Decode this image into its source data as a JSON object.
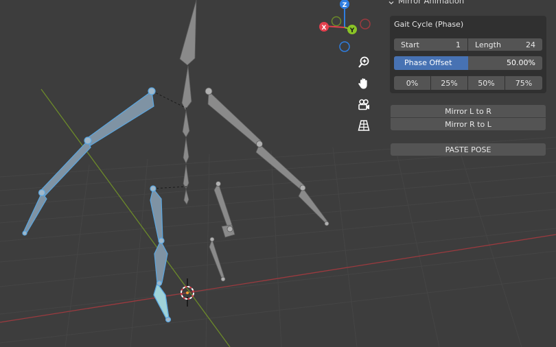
{
  "panel": {
    "title": "Mirror Animation",
    "gait_title": "Gait Cycle (Phase)",
    "start_label": "Start",
    "start_value": "1",
    "length_label": "Length",
    "length_value": "24",
    "phase_label": "Phase Offset",
    "phase_value": "50.00%",
    "phase_fraction": 0.5,
    "presets": [
      "0%",
      "25%",
      "50%",
      "75%"
    ],
    "mirror_lr": "Mirror L to R",
    "mirror_rl": "Mirror R to L",
    "paste_pose": "PASTE POSE"
  },
  "gizmo": {
    "x_label": "X",
    "y_label": "Y",
    "z_label": "Z"
  },
  "tools": [
    "zoom-icon",
    "pan-hand-icon",
    "camera-icon",
    "grid-icon"
  ],
  "colors": {
    "background": "#3d3d3d",
    "x_axis": "#e4404e",
    "y_axis": "#8ac426",
    "z_axis": "#2f7ee0",
    "selection": "#5aa6e0",
    "slider_fill": "#4772b3"
  }
}
